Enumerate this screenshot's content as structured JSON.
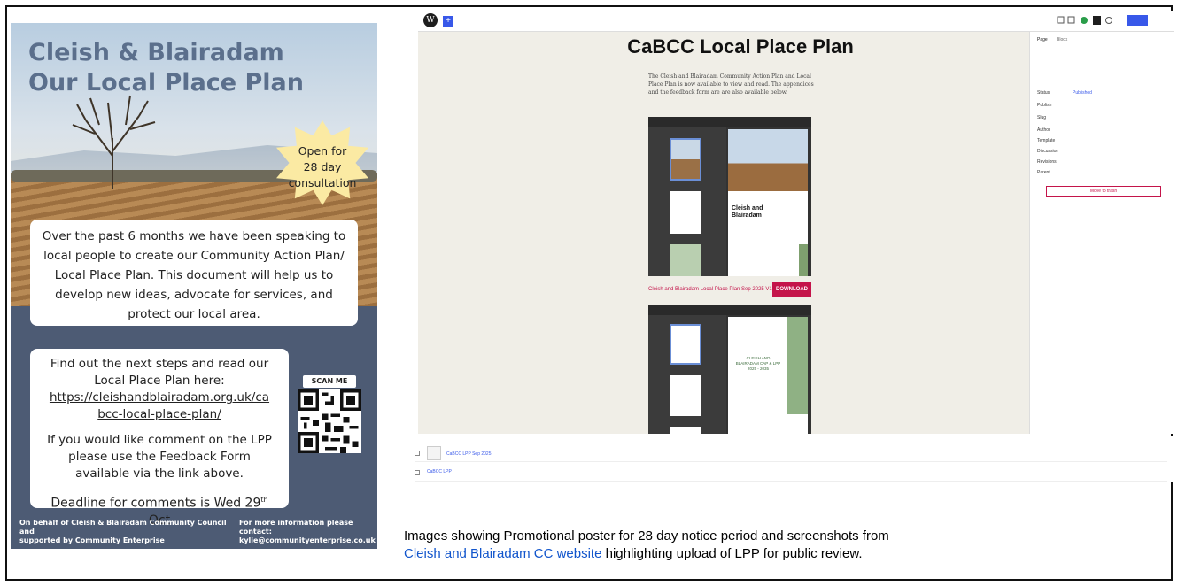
{
  "poster": {
    "title_line1": "Cleish & Blairadam",
    "title_line2": "Our Local Place Plan",
    "starburst": [
      "Open for",
      "28 day",
      "consultation"
    ],
    "intro_lines": [
      "Over the past 6 months we have been speaking to",
      "local people to create our Community Action Plan/",
      "Local Place Plan. This document will help us to",
      "develop new ideas, advocate for services, and",
      "protect our local area."
    ],
    "steps_lines": [
      "Find out the next steps and read our",
      "Local Place Plan here:"
    ],
    "url_lines": [
      "https://cleishandblairadam.org.uk/ca",
      "bcc-local-place-plan/"
    ],
    "comment_lines": [
      "If you would like comment on the LPP",
      "please use the Feedback Form",
      "available via the link above."
    ],
    "deadline": "Deadline for comments is Wed 29",
    "deadline_sup": "th",
    "deadline_tail": " Oct",
    "qr_label": "SCAN ME",
    "footer_left": [
      "On behalf of Cleish & Blairadam Community Council and",
      "supported by Community Enterprise"
    ],
    "footer_right": [
      "For more information please contact:",
      "kylie@communityenterprise.co.uk"
    ]
  },
  "screenshot": {
    "page_title": "CaBCC Local Place Plan",
    "intro": "The Cleish and Blairadam Community Action Plan and Local Place Plan is now available to view and read. The appendices and the feedback form are are also available below.",
    "pdf1_cover_title": [
      "Cleish and",
      "Blairadam"
    ],
    "pdf2_cover_title": [
      "CLEISH AND",
      "BLAIRADAM CAP & LPP",
      "2025 - 2035"
    ],
    "download_link": "Cleish and Blairadam Local Place Plan Sep 2025 V1",
    "download_button": "DOWNLOAD",
    "sidebar": {
      "tabs": [
        "Page",
        "Block"
      ],
      "rows": [
        {
          "k": "Status",
          "v": "Published"
        },
        {
          "k": "Publish",
          "v": ""
        },
        {
          "k": "Slug",
          "v": ""
        },
        {
          "k": "Author",
          "v": ""
        },
        {
          "k": "Template",
          "v": ""
        },
        {
          "k": "Discussion",
          "v": ""
        },
        {
          "k": "Revisions",
          "v": ""
        },
        {
          "k": "Parent",
          "v": ""
        }
      ],
      "trash": "Move to trash"
    },
    "list_rows": [
      "CaBCC LPP Sep 2025",
      "CaBCC LPP"
    ]
  },
  "caption": {
    "line1": "Images showing Promotional poster for 28 day notice period and screenshots from",
    "link": "Cleish and Blairadam CC website",
    "line2_tail": " highlighting upload of LPP for public review."
  }
}
